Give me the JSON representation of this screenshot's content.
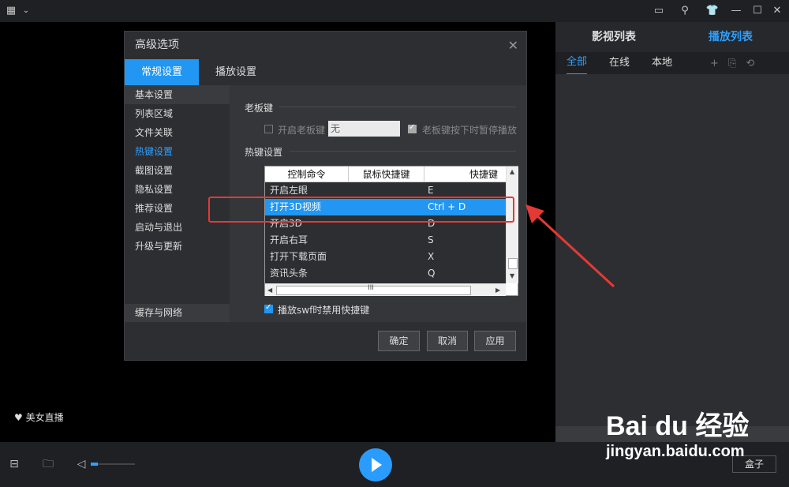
{
  "topbar": {
    "left_icons": [
      "layout-icon",
      "chevron-down-icon"
    ],
    "right_icons": [
      "comment-icon",
      "pin-icon",
      "tshirt-icon",
      "minimize-icon",
      "maximize-icon",
      "close-icon"
    ]
  },
  "right_panel": {
    "tabs": [
      "影视列表",
      "播放列表"
    ],
    "subtabs": [
      "全部",
      "在线",
      "本地"
    ],
    "tools": [
      "add-icon",
      "remove-file-icon",
      "refresh-icon"
    ]
  },
  "overlay": {
    "beauty_live": "美女直播"
  },
  "bottom": {
    "box_label": "盒子",
    "volume_level_pct": 16
  },
  "dialog": {
    "title": "高级选项",
    "tabs": [
      "常规设置",
      "播放设置"
    ],
    "sidebar": [
      "基本设置",
      "列表区域",
      "文件关联",
      "热键设置",
      "截图设置",
      "隐私设置",
      "推荐设置",
      "启动与退出",
      "升级与更新"
    ],
    "sidebar_bottom": "缓存与网络",
    "boss_key": {
      "section": "老板键",
      "enable_label": "开启老板键",
      "value": "无",
      "pause_label": "老板键按下时暂停播放"
    },
    "hotkeys": {
      "section": "热键设置",
      "columns": [
        "控制命令",
        "鼠标快捷键",
        "快捷键"
      ],
      "rows": [
        {
          "cmd": "开启左眼",
          "key": "E"
        },
        {
          "cmd": "打开3D视频",
          "key": "Ctrl + D"
        },
        {
          "cmd": "开启3D",
          "key": "D"
        },
        {
          "cmd": "开启右耳",
          "key": "S"
        },
        {
          "cmd": "打开下载页面",
          "key": "X"
        },
        {
          "cmd": "资讯头条",
          "key": "Q"
        }
      ],
      "hscroll_label": "III"
    },
    "swf_label": "播放swf时禁用快捷键",
    "buttons": {
      "ok": "确定",
      "cancel": "取消",
      "apply": "应用"
    }
  },
  "watermark": {
    "logo": "Bai du 经验",
    "url": "jingyan.baidu.com"
  }
}
